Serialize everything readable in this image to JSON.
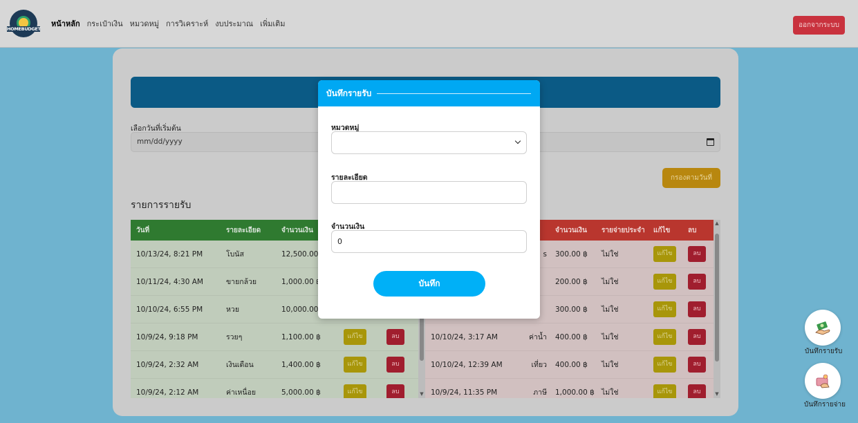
{
  "nav": {
    "logo_text": "HOMEBUDGET",
    "links": [
      "หน้าหลัก",
      "กระเป๋าเงิน",
      "หมวดหมู่",
      "การวิเคราะห์",
      "งบประมาณ",
      "เพิ่มเติม"
    ],
    "active_index": 0,
    "logout_label": "ออกจากระบบ"
  },
  "filter": {
    "start_date_label": "เลือกวันที่เริ่มต้น",
    "start_date_placeholder": "mm/dd/yyyy",
    "filter_button": "กรองตามวันที่"
  },
  "income_section_title": "รายการรายรับ",
  "income_table": {
    "headers": [
      "วันที่",
      "รายละเอียด",
      "จำนวนเงิน"
    ],
    "rows": [
      {
        "date": "10/13/24, 8:21 PM",
        "detail": "โบนัส",
        "amount": "12,500.00 ฿"
      },
      {
        "date": "10/11/24, 4:30 AM",
        "detail": "ขายกล้วย",
        "amount": "1,000.00 ฿"
      },
      {
        "date": "10/10/24, 6:55 PM",
        "detail": "หวย",
        "amount": "10,000.00 ฿"
      },
      {
        "date": "10/9/24, 9:18 PM",
        "detail": "รวยๆ",
        "amount": "1,100.00 ฿"
      },
      {
        "date": "10/9/24, 2:32 AM",
        "detail": "เงินเดือน",
        "amount": "1,400.00 ฿"
      },
      {
        "date": "10/9/24, 2:12 AM",
        "detail": "ค่าเหนื่อย",
        "amount": "5,000.00 ฿"
      }
    ],
    "edit_label": "แก้ไข",
    "delete_label": "ลบ"
  },
  "expense_table": {
    "headers": [
      "จำนวนเงิน",
      "รายจ่ายประจำ",
      "แก้ไข",
      "ลบ"
    ],
    "rows": [
      {
        "date": "",
        "detail": "s",
        "amount": "300.00 ฿",
        "recurring": "ไม่ใช่"
      },
      {
        "date": "",
        "detail": "",
        "amount": "200.00 ฿",
        "recurring": "ไม่ใช่"
      },
      {
        "date": "",
        "detail": "",
        "amount": "300.00 ฿",
        "recurring": "ไม่ใช่"
      },
      {
        "date": "10/10/24, 3:17 AM",
        "detail": "ค่าน้ำ",
        "amount": "400.00 ฿",
        "recurring": "ไม่ใช่"
      },
      {
        "date": "10/10/24, 12:39 AM",
        "detail": "เที่ยว",
        "amount": "400.00 ฿",
        "recurring": "ไม่ใช่"
      },
      {
        "date": "10/9/24, 11:35 PM",
        "detail": "ภาษี",
        "amount": "1,000.00 ฿",
        "recurring": "ไม่ใช่"
      }
    ],
    "edit_label": "แก้ไข",
    "delete_label": "ลบ"
  },
  "modal": {
    "title": "บันทึกรายรับ",
    "category_label": "หมวดหมู่",
    "category_value": "",
    "detail_label": "รายละเอียด",
    "detail_value": "",
    "amount_label": "จำนวนเงิน",
    "amount_value": "0",
    "save_label": "บันทึก"
  },
  "fabs": {
    "income_label": "บันทึกรายรับ",
    "expense_label": "บันทึกรายจ่าย"
  }
}
